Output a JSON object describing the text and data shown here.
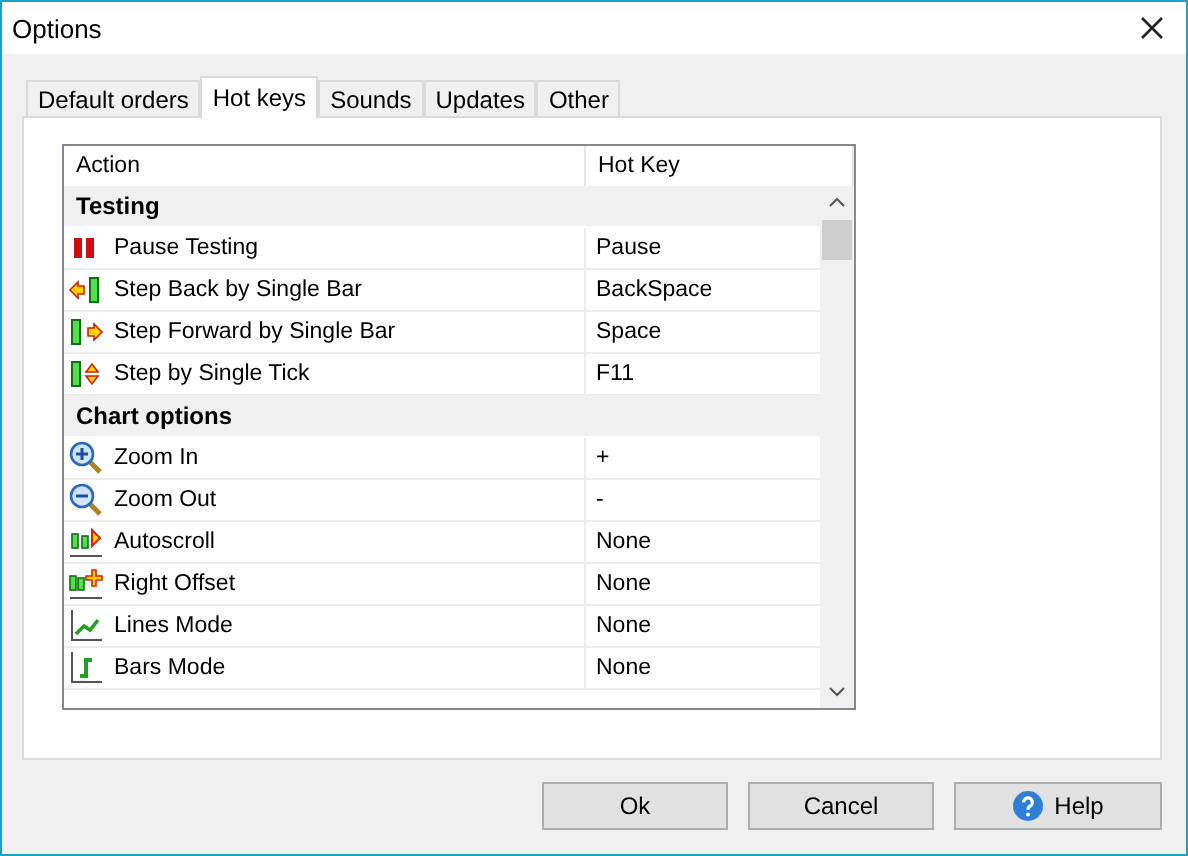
{
  "window": {
    "title": "Options"
  },
  "tabs": [
    {
      "label": "Default orders",
      "selected": false
    },
    {
      "label": "Hot keys",
      "selected": true
    },
    {
      "label": "Sounds",
      "selected": false
    },
    {
      "label": "Updates",
      "selected": false
    },
    {
      "label": "Other",
      "selected": false
    }
  ],
  "table": {
    "columns": [
      "Action",
      "Hot Key"
    ],
    "groups": [
      {
        "title": "Testing",
        "rows": [
          {
            "action": "Pause Testing",
            "hotkey": "Pause"
          },
          {
            "action": "Step Back by Single Bar",
            "hotkey": "BackSpace"
          },
          {
            "action": "Step Forward by Single Bar",
            "hotkey": "Space"
          },
          {
            "action": "Step by Single Tick",
            "hotkey": "F11"
          }
        ]
      },
      {
        "title": "Chart options",
        "rows": [
          {
            "action": "Zoom In",
            "hotkey": "+"
          },
          {
            "action": "Zoom Out",
            "hotkey": "-"
          },
          {
            "action": "Autoscroll",
            "hotkey": "None"
          },
          {
            "action": "Right Offset",
            "hotkey": "None"
          },
          {
            "action": "Lines Mode",
            "hotkey": "None"
          },
          {
            "action": "Bars Mode",
            "hotkey": "None"
          }
        ]
      }
    ]
  },
  "buttons": [
    {
      "label": "Ok",
      "kind": "plain"
    },
    {
      "label": "Cancel",
      "kind": "plain"
    },
    {
      "label": "Help",
      "kind": "help"
    }
  ]
}
